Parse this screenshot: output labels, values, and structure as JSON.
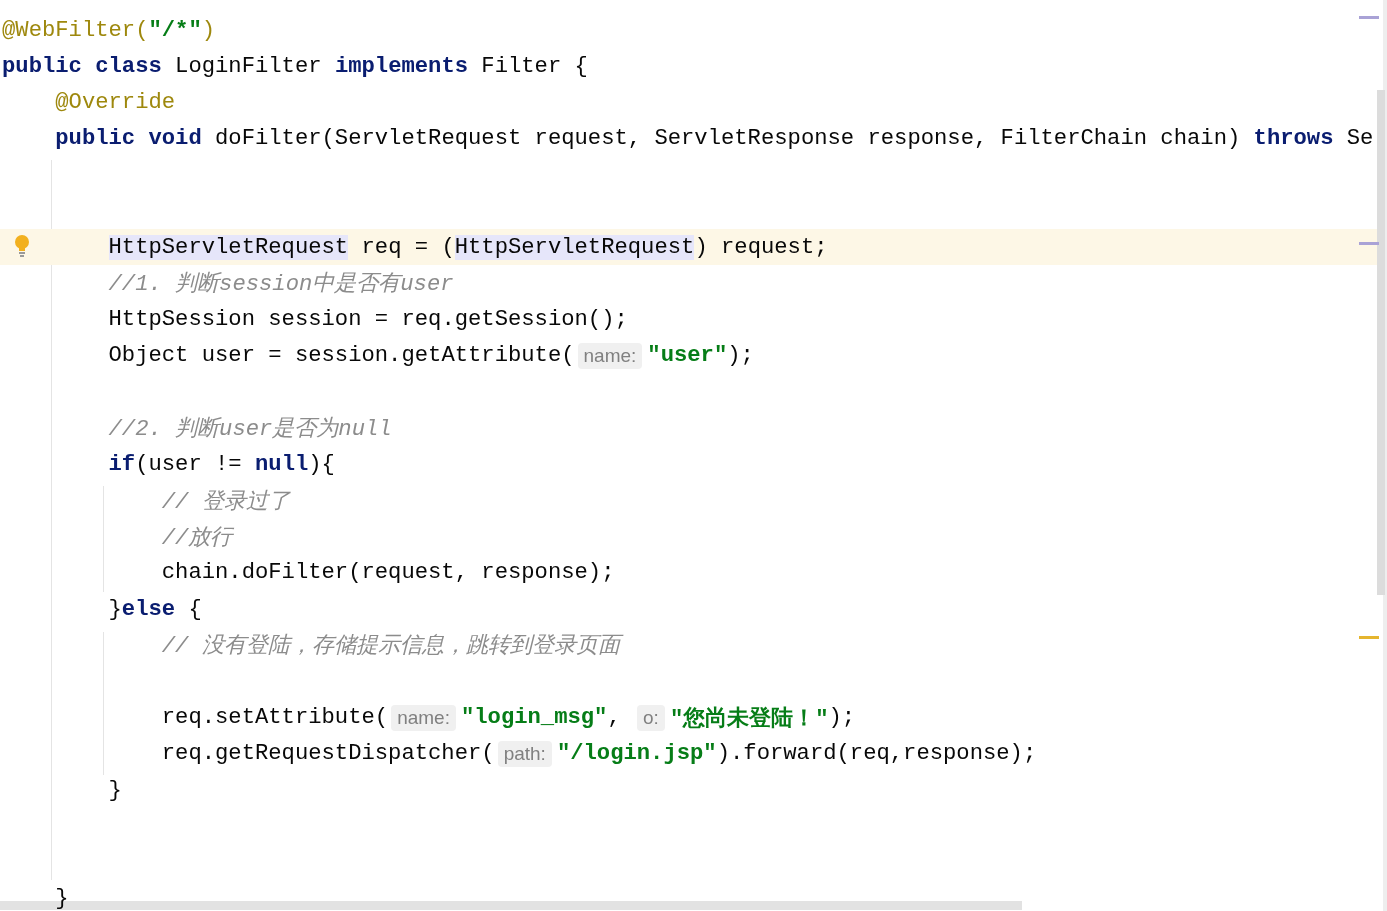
{
  "editor": {
    "lines": [
      {
        "current": false,
        "tokens": [
          {
            "kind": "annotation",
            "text": "@WebFilter("
          },
          {
            "kind": "string",
            "text": "\"/*\""
          },
          {
            "kind": "annotation",
            "text": ")"
          }
        ]
      },
      {
        "current": false,
        "tokens": [
          {
            "kind": "keyword",
            "text": "public class "
          },
          {
            "kind": "plain",
            "text": "LoginFilter "
          },
          {
            "kind": "keyword",
            "text": "implements "
          },
          {
            "kind": "plain",
            "text": "Filter {"
          }
        ],
        "children": [
          {
            "current": false,
            "tokens": [
              {
                "kind": "annotation",
                "text": "@Override"
              }
            ]
          },
          {
            "current": false,
            "tokens": [
              {
                "kind": "keyword",
                "text": "public void "
              },
              {
                "kind": "plain",
                "text": "doFilter(ServletRequest request, ServletResponse response, FilterChain chain) "
              },
              {
                "kind": "keyword",
                "text": "throws "
              },
              {
                "kind": "plain",
                "text": "Se"
              }
            ],
            "children": [
              {
                "current": false
              },
              {
                "current": false
              },
              {
                "current": true,
                "tokens": [
                  {
                    "kind": "usage",
                    "text": "HttpServletRequest"
                  },
                  {
                    "kind": "plain",
                    "text": " req = ("
                  },
                  {
                    "kind": "usage",
                    "text": "HttpServletRequest"
                  },
                  {
                    "kind": "plain",
                    "text": ") request;"
                  }
                ]
              },
              {
                "current": false,
                "tokens": [
                  {
                    "kind": "comment",
                    "text": "//1. 判断session中是否有user"
                  }
                ]
              },
              {
                "current": false,
                "tokens": [
                  {
                    "kind": "plain",
                    "text": "HttpSession session = req.getSession();"
                  }
                ]
              },
              {
                "current": false,
                "tokens": [
                  {
                    "kind": "plain",
                    "text": "Object user = session.getAttribute("
                  },
                  {
                    "kind": "hint",
                    "text": "name:"
                  },
                  {
                    "kind": "string",
                    "text": "\"user\""
                  },
                  {
                    "kind": "plain",
                    "text": ");"
                  }
                ]
              },
              {
                "current": false
              },
              {
                "current": false,
                "tokens": [
                  {
                    "kind": "comment",
                    "text": "//2. 判断user是否为null"
                  }
                ]
              },
              {
                "current": false,
                "tokens": [
                  {
                    "kind": "keyword",
                    "text": "if"
                  },
                  {
                    "kind": "plain",
                    "text": "(user != "
                  },
                  {
                    "kind": "keyword",
                    "text": "null"
                  },
                  {
                    "kind": "plain",
                    "text": "){"
                  }
                ],
                "children": [
                  {
                    "current": false,
                    "tokens": [
                      {
                        "kind": "comment",
                        "text": "// 登录过了"
                      }
                    ]
                  },
                  {
                    "current": false,
                    "tokens": [
                      {
                        "kind": "comment",
                        "text": "//放行"
                      }
                    ]
                  },
                  {
                    "current": false,
                    "tokens": [
                      {
                        "kind": "plain",
                        "text": "chain.doFilter(request, response);"
                      }
                    ]
                  }
                ]
              },
              {
                "current": false,
                "tokens": [
                  {
                    "kind": "plain",
                    "text": "}"
                  },
                  {
                    "kind": "keyword",
                    "text": "else"
                  },
                  {
                    "kind": "plain",
                    "text": " {"
                  }
                ],
                "children": [
                  {
                    "current": false,
                    "tokens": [
                      {
                        "kind": "comment",
                        "text": "// 没有登陆，存储提示信息，跳转到登录页面"
                      }
                    ]
                  },
                  {
                    "current": false
                  },
                  {
                    "current": false,
                    "tokens": [
                      {
                        "kind": "plain",
                        "text": "req.setAttribute("
                      },
                      {
                        "kind": "hint",
                        "text": "name:"
                      },
                      {
                        "kind": "string",
                        "text": "\"login_msg\""
                      },
                      {
                        "kind": "plain",
                        "text": ", "
                      },
                      {
                        "kind": "hint",
                        "text": "o:"
                      },
                      {
                        "kind": "string",
                        "text": "\"您尚未登陆！\""
                      },
                      {
                        "kind": "plain",
                        "text": ");"
                      }
                    ]
                  },
                  {
                    "current": false,
                    "tokens": [
                      {
                        "kind": "plain",
                        "text": "req.getRequestDispatcher("
                      },
                      {
                        "kind": "hint",
                        "text": "path:"
                      },
                      {
                        "kind": "string",
                        "text": "\"/login.jsp\""
                      },
                      {
                        "kind": "plain",
                        "text": ").forward(req,response);"
                      }
                    ]
                  }
                ]
              },
              {
                "current": false,
                "tokens": [
                  {
                    "kind": "plain",
                    "text": "}"
                  }
                ]
              },
              {
                "current": false
              },
              {
                "current": false
              }
            ]
          },
          {
            "current": false,
            "tokens": [
              {
                "kind": "plain",
                "text": "}"
              }
            ]
          }
        ]
      }
    ]
  }
}
